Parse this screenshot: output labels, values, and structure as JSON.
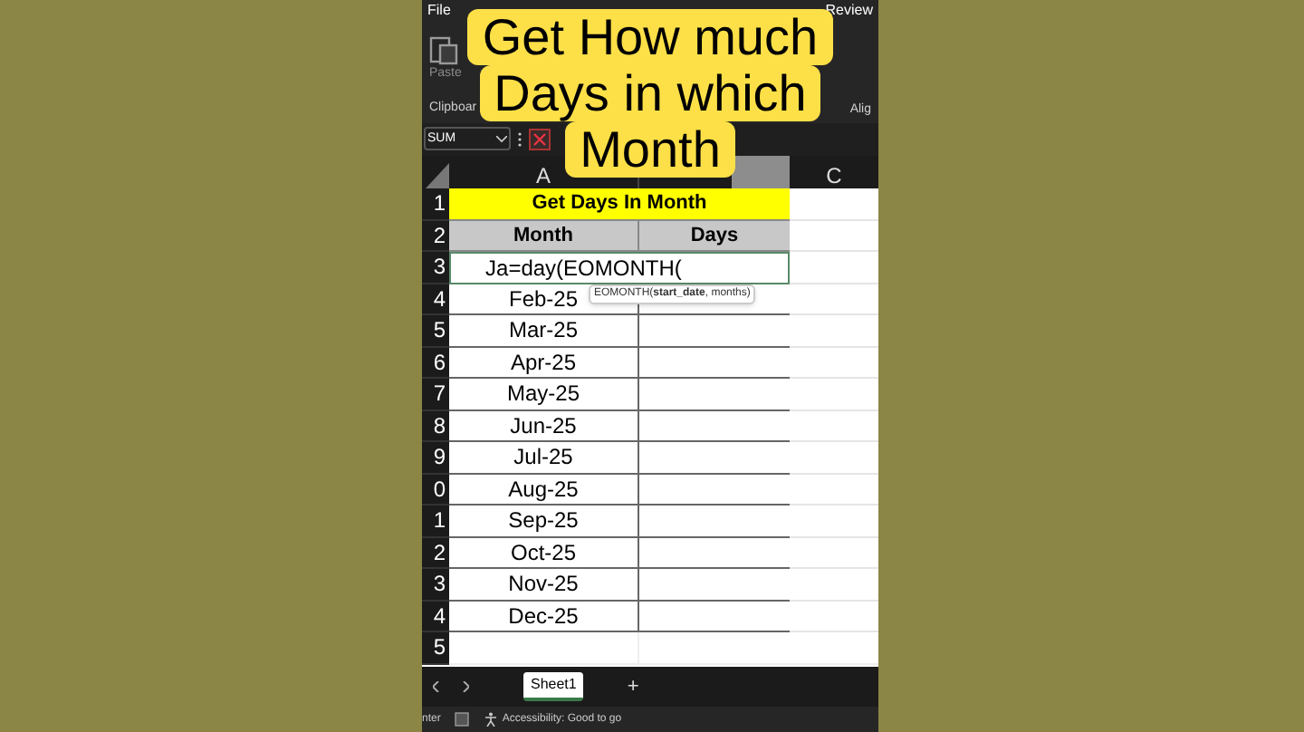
{
  "title": {
    "lines": [
      "Get How much",
      "Days in which",
      "Month"
    ]
  },
  "ribbon": {
    "tabs": [
      "File",
      "Review"
    ],
    "paste": "Paste",
    "groups": [
      "Clipboar",
      "Alig"
    ]
  },
  "formula_bar": {
    "name_box": "SUM"
  },
  "columns": [
    "A",
    "C"
  ],
  "sheet": {
    "banner": "Get Days In Month",
    "headers": [
      "Month",
      "Days"
    ],
    "rows": [
      {
        "num": "3",
        "month": "Ja",
        "editing": true,
        "formula": "=day(EOMONTH(",
        "tooltip": "EOMONTH(**start_date**, months)"
      },
      {
        "num": "4",
        "month": "Feb-25",
        "editing": false
      },
      {
        "num": "5",
        "month": "Mar-25",
        "editing": false
      },
      {
        "num": "6",
        "month": "Apr-25",
        "editing": false
      },
      {
        "num": "7",
        "month": "May-25",
        "editing": false
      },
      {
        "num": "8",
        "month": "Jun-25",
        "editing": false
      },
      {
        "num": "9",
        "month": "Jul-25",
        "editing": false
      },
      {
        "num": "0",
        "month": "Aug-25",
        "editing": false
      },
      {
        "num": "1",
        "month": "Sep-25",
        "editing": false
      },
      {
        "num": "2",
        "month": "Oct-25",
        "editing": false
      },
      {
        "num": "3",
        "month": "Nov-25",
        "editing": false
      },
      {
        "num": "4",
        "month": "Dec-25",
        "editing": false
      }
    ],
    "header_nums": [
      "1",
      "2"
    ],
    "empty_rows": [
      "5"
    ]
  },
  "sheet_tabs": [
    {
      "label": "Sheet1",
      "selected": true
    }
  ],
  "add_sheet": "+",
  "status_bar": {
    "mode": "nter",
    "accessibility": "Accessibility: Good to go"
  }
}
